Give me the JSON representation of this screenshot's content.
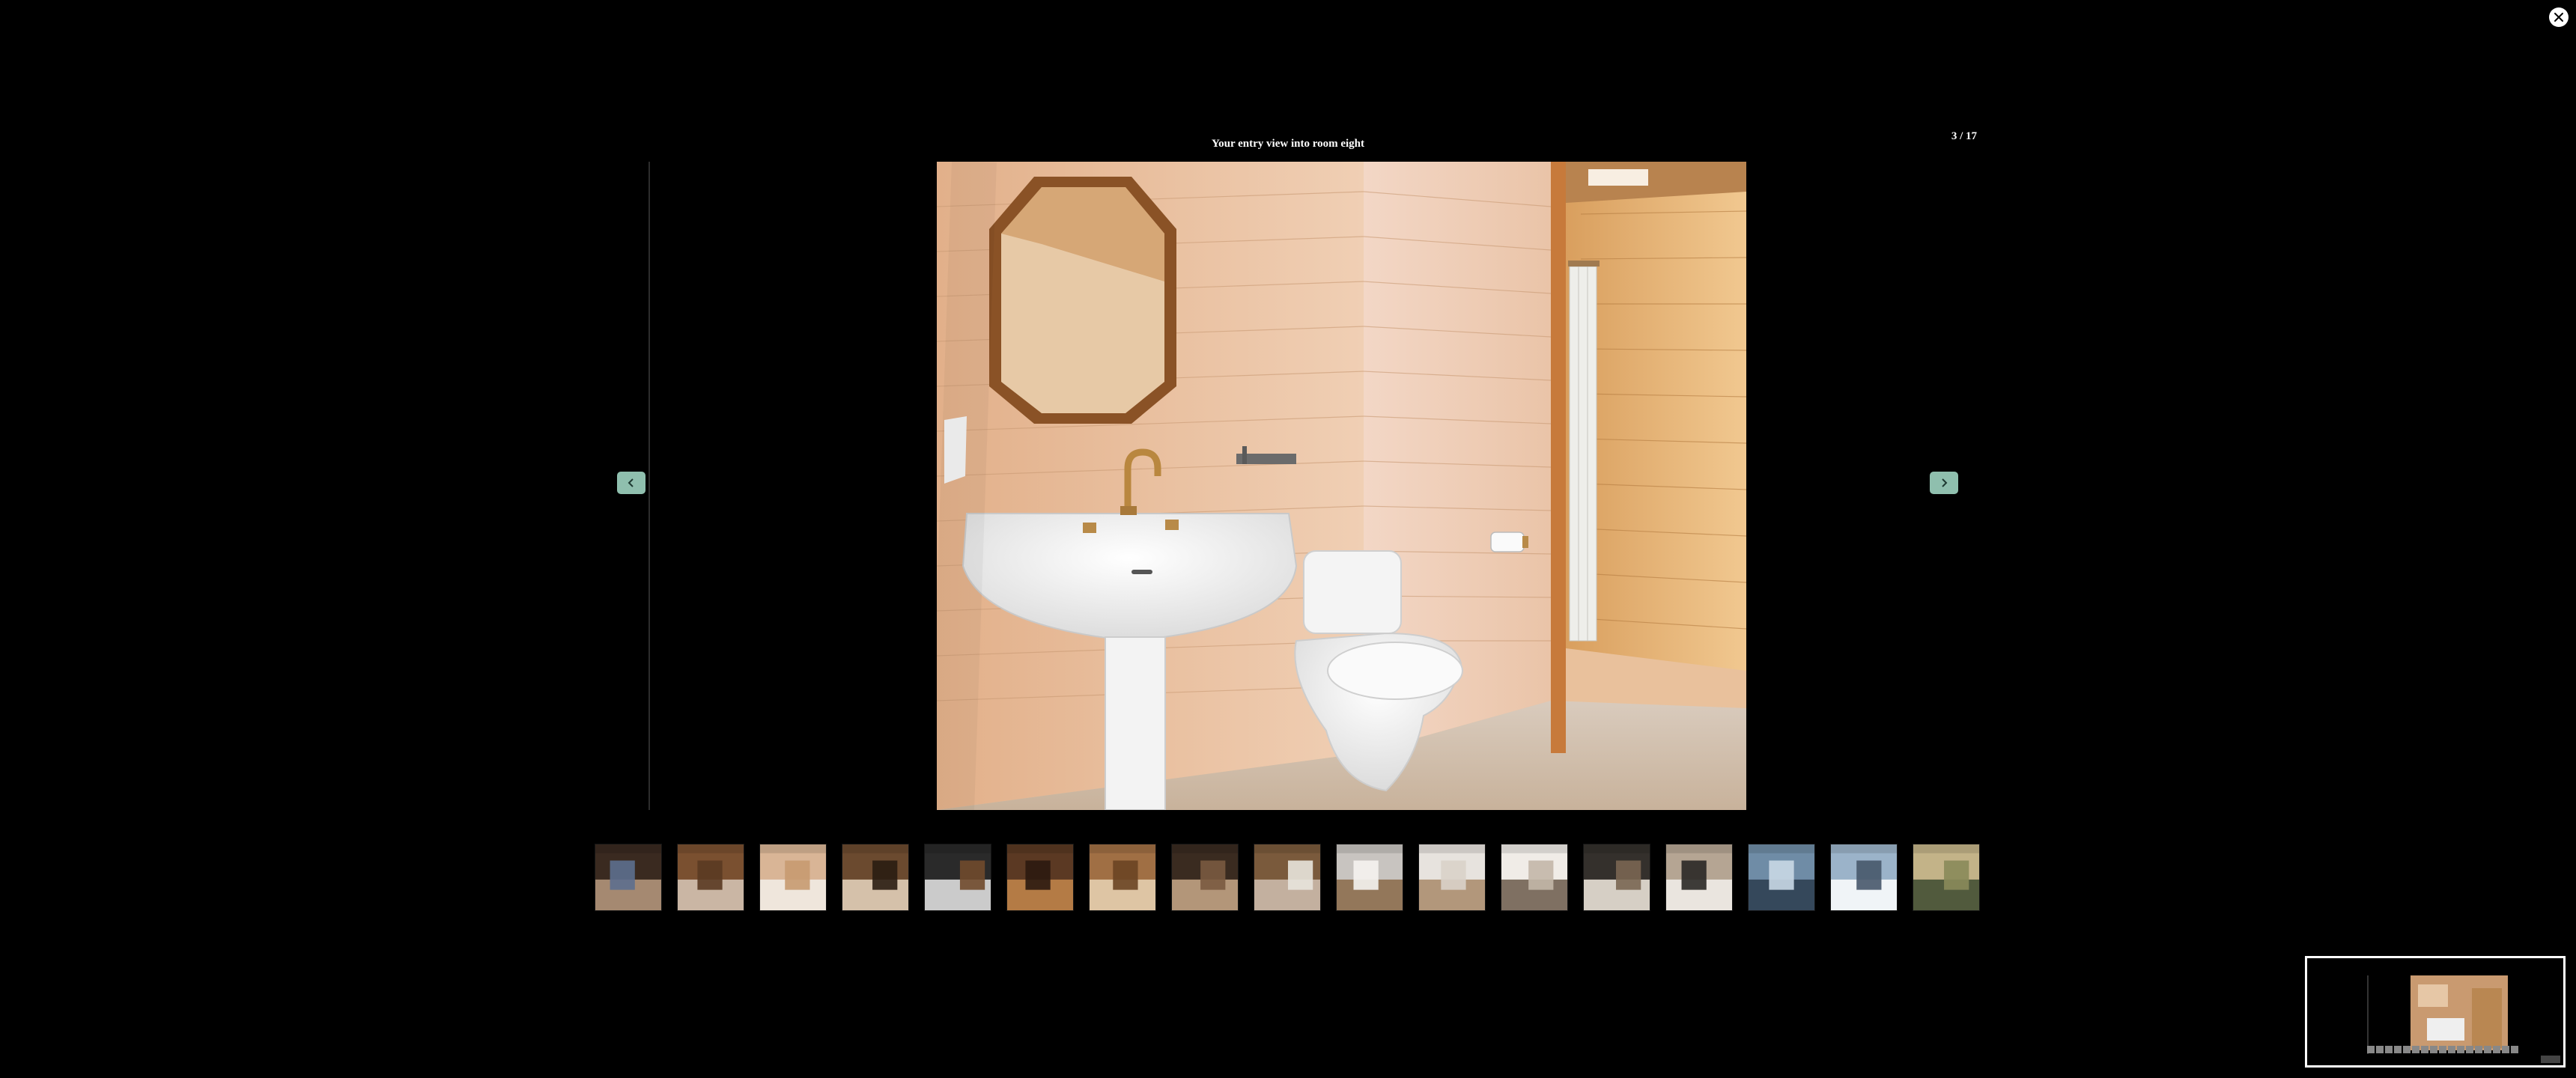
{
  "viewer": {
    "caption": "Your entry view into room eight",
    "counter": "3 / 17",
    "current_index": 3,
    "total_images": 17
  },
  "controls": {
    "close_icon": "close-icon",
    "prev_icon": "chevron-left-icon",
    "next_icon": "chevron-right-icon",
    "arrow_color": "#8fbfae"
  },
  "main_image": {
    "subject": "bathroom-with-pedestal-sink-toilet-and-shower",
    "wall_color": "#e9c19c",
    "floor_color": "#d7c3ad"
  },
  "thumbnails": [
    {
      "subject": "bedroom",
      "colors": [
        "#3a2a20",
        "#b89a80",
        "#5d6f8e"
      ]
    },
    {
      "subject": "doorway",
      "colors": [
        "#7a5030",
        "#d8c8b8",
        "#5a3a22"
      ]
    },
    {
      "subject": "bathroom-sink",
      "colors": [
        "#d9b596",
        "#f2efe9",
        "#c69a70"
      ]
    },
    {
      "subject": "wood-wall-hooks",
      "colors": [
        "#6b4a2f",
        "#e8d6c0",
        "#2a1d12"
      ]
    },
    {
      "subject": "checkered-floor",
      "colors": [
        "#2a2a2a",
        "#e7e7e7",
        "#704a2c"
      ]
    },
    {
      "subject": "lamp-corner",
      "colors": [
        "#5b3923",
        "#c4874b",
        "#2b1a10"
      ]
    },
    {
      "subject": "wooden-sign",
      "colors": [
        "#a06f44",
        "#e9d5b5",
        "#6a4424"
      ]
    },
    {
      "subject": "sculpture",
      "colors": [
        "#3a2b20",
        "#c9a98a",
        "#7a5a40"
      ]
    },
    {
      "subject": "shelf-with-towels",
      "colors": [
        "#7a5a3c",
        "#d0c0b0",
        "#e8e4dc"
      ]
    },
    {
      "subject": "kitchen-counter",
      "colors": [
        "#c8c4c0",
        "#8a6a48",
        "#f5f3f0"
      ]
    },
    {
      "subject": "white-room-door",
      "colors": [
        "#e7e3de",
        "#a88a6a",
        "#d9d2c9"
      ]
    },
    {
      "subject": "shelves",
      "colors": [
        "#f0ece7",
        "#6b5a4a",
        "#c3b7a9"
      ]
    },
    {
      "subject": "dark-interior",
      "colors": [
        "#34302c",
        "#f3ebe1",
        "#7a6652"
      ]
    },
    {
      "subject": "kitchen",
      "colors": [
        "#b5a593",
        "#f3f0ec",
        "#2a2826"
      ]
    },
    {
      "subject": "lake-mountains",
      "colors": [
        "#6f8ca6",
        "#2c3c4d",
        "#c9d8e6"
      ]
    },
    {
      "subject": "snowy-mountains",
      "colors": [
        "#9bb3c9",
        "#ffffff",
        "#47586a"
      ]
    },
    {
      "subject": "valley-sunset",
      "colors": [
        "#c3b388",
        "#3d4a30",
        "#8a8a5a"
      ]
    }
  ]
}
